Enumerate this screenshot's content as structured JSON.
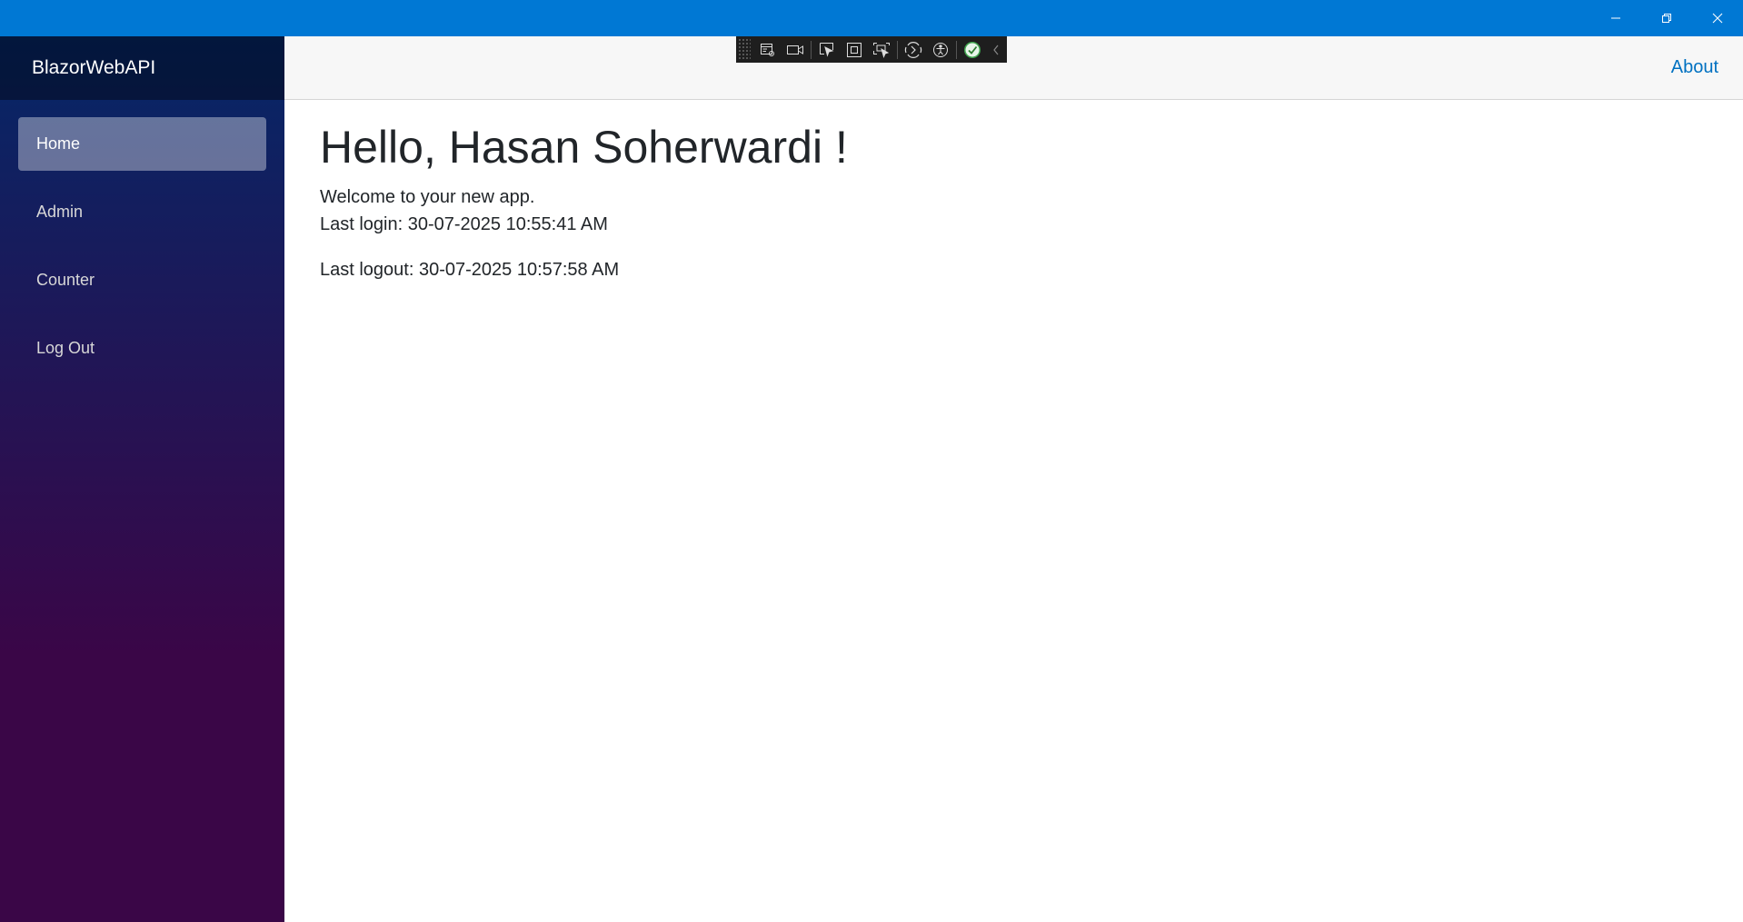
{
  "window": {
    "controls": [
      "minimize-icon",
      "restore-icon",
      "close-icon"
    ],
    "titlebar_color": "#0078d4"
  },
  "sidebar": {
    "brand": "BlazorWebAPI",
    "items": [
      {
        "label": "Home",
        "active": true
      },
      {
        "label": "Admin",
        "active": false
      },
      {
        "label": "Counter",
        "active": false
      },
      {
        "label": "Log Out",
        "active": false
      }
    ]
  },
  "header": {
    "about_label": "About"
  },
  "main": {
    "greeting": "Hello, Hasan Soherwardi !",
    "welcome": "Welcome to your new app.",
    "last_login": "Last login: 30-07-2025 10:55:41 AM",
    "last_logout": "Last logout: 30-07-2025 10:57:58 AM"
  },
  "debug_toolbar": {
    "icons": [
      "live-visual-tree-icon",
      "record-icon",
      "select-element-icon",
      "display-layout-adorners-icon",
      "track-focus-icon",
      "hot-reload-icon",
      "accessibility-icon",
      "status-ok-icon",
      "collapse-chevron-icon"
    ]
  },
  "colors": {
    "accent_link": "#0071c1",
    "sidebar_top": "#052767",
    "sidebar_bottom": "#3a0647"
  }
}
